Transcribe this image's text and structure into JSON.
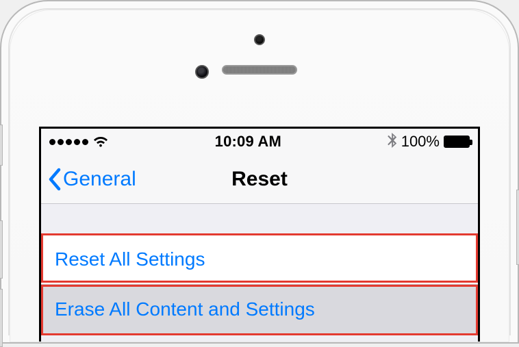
{
  "statusbar": {
    "time": "10:09 AM",
    "battery_pct": "100%"
  },
  "nav": {
    "back_label": "General",
    "title": "Reset"
  },
  "cells": {
    "reset_all": "Reset All Settings",
    "erase_all": "Erase All Content and Settings"
  }
}
